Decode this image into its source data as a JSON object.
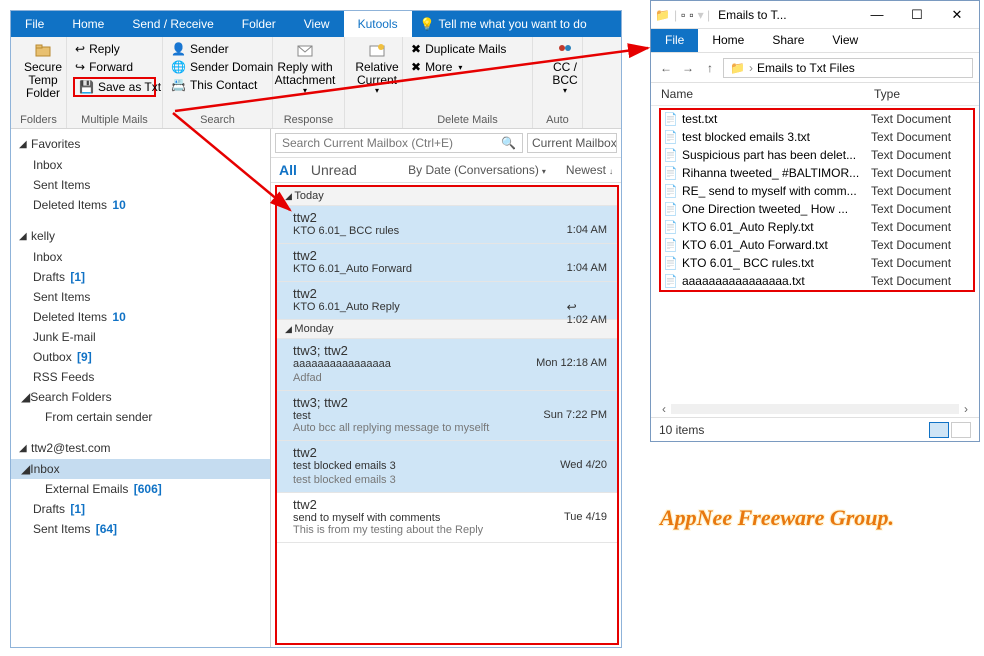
{
  "outlook": {
    "tabs": [
      "File",
      "Home",
      "Send / Receive",
      "Folder",
      "View",
      "Kutools"
    ],
    "tell_me": "Tell me what you want to do",
    "ribbon": {
      "folders": {
        "secure_temp": "Secure\nTemp Folder",
        "label": "Folders"
      },
      "multiple": {
        "reply": "Reply",
        "forward": "Forward",
        "save_as_txt": "Save as Txt",
        "label": "Multiple Mails"
      },
      "search": {
        "sender": "Sender",
        "sender_domain": "Sender Domain",
        "this_contact": "This Contact",
        "label": "Search"
      },
      "response": {
        "reply_attach": "Reply with\nAttachment",
        "label": "Response"
      },
      "relative": {
        "current": "Relative\nCurrent",
        "label": ""
      },
      "delete": {
        "duplicate": "Duplicate Mails",
        "more": "More",
        "label": "Delete Mails"
      },
      "ccbcc": {
        "ccbcc": "CC /\nBCC",
        "label": "Auto"
      }
    },
    "nav": {
      "favorites": {
        "label": "Favorites",
        "items": [
          {
            "label": "Inbox"
          },
          {
            "label": "Sent Items"
          },
          {
            "label": "Deleted Items",
            "count": "10"
          }
        ]
      },
      "kelly": {
        "label": "kelly",
        "items": [
          {
            "label": "Inbox"
          },
          {
            "label": "Drafts",
            "count": "[1]"
          },
          {
            "label": "Sent Items"
          },
          {
            "label": "Deleted Items",
            "count": "10"
          },
          {
            "label": "Junk E-mail"
          },
          {
            "label": "Outbox",
            "count": "[9]"
          },
          {
            "label": "RSS Feeds"
          },
          {
            "label": "Search Folders",
            "expandable": true
          },
          {
            "label": "From certain sender",
            "sub": true
          }
        ]
      },
      "ttw2": {
        "label": "ttw2@test.com",
        "items": [
          {
            "label": "Inbox",
            "expandable": true,
            "selected": true
          },
          {
            "label": "External Emails",
            "count": "[606]",
            "sub": true
          },
          {
            "label": "Drafts",
            "count": "[1]"
          },
          {
            "label": "Sent Items",
            "count": "[64]"
          }
        ]
      }
    },
    "search": {
      "placeholder": "Search Current Mailbox (Ctrl+E)",
      "scope": "Current Mailbox"
    },
    "filters": {
      "all": "All",
      "unread": "Unread",
      "by": "By Date (Conversations)",
      "newest": "Newest"
    },
    "messages": {
      "groups": [
        {
          "label": "Today",
          "items": [
            {
              "from": "ttw2",
              "subj": "KTO 6.01_ BCC rules",
              "time": "1:04 AM",
              "sel": true
            },
            {
              "from": "ttw2",
              "subj": "KTO 6.01_Auto Forward",
              "time": "1:04 AM",
              "sel": true
            },
            {
              "from": "ttw2",
              "subj": "KTO 6.01_Auto Reply",
              "time": "1:02 AM",
              "sel": true,
              "icon": "reply"
            }
          ]
        },
        {
          "label": "Monday",
          "items": [
            {
              "from": "ttw3; ttw2",
              "subj": "aaaaaaaaaaaaaaaa",
              "prev": "Adfad <end>",
              "time": "Mon 12:18 AM",
              "sel": true
            },
            {
              "from": "ttw3; ttw2",
              "subj": "test",
              "prev": "Auto bcc all replying message to myselft",
              "time": "Sun 7:22 PM",
              "sel": true
            },
            {
              "from": "ttw2",
              "subj": "test blocked emails 3",
              "prev": "test blocked emails 3 <end>",
              "time": "Wed 4/20",
              "sel": true
            },
            {
              "from": "ttw2",
              "subj": "send to myself with comments",
              "prev": "This is from my testing about the Reply",
              "time": "Tue 4/19",
              "plain": true
            }
          ]
        }
      ]
    }
  },
  "explorer": {
    "title": "Emails to T...",
    "tabs": [
      "File",
      "Home",
      "Share",
      "View"
    ],
    "crumb": "Emails to Txt Files",
    "cols": {
      "name": "Name",
      "type": "Type"
    },
    "files": [
      {
        "name": "test.txt",
        "type": "Text Document"
      },
      {
        "name": "test blocked emails 3.txt",
        "type": "Text Document"
      },
      {
        "name": "Suspicious part has been delet...",
        "type": "Text Document"
      },
      {
        "name": "Rihanna tweeted_ #BALTIMOR...",
        "type": "Text Document"
      },
      {
        "name": "RE_ send to myself with comm...",
        "type": "Text Document"
      },
      {
        "name": "One Direction tweeted_ How ...",
        "type": "Text Document"
      },
      {
        "name": "KTO 6.01_Auto Reply.txt",
        "type": "Text Document"
      },
      {
        "name": "KTO 6.01_Auto Forward.txt",
        "type": "Text Document"
      },
      {
        "name": "KTO 6.01_ BCC rules.txt",
        "type": "Text Document"
      },
      {
        "name": "aaaaaaaaaaaaaaaa.txt",
        "type": "Text Document"
      }
    ],
    "status": "10 items"
  },
  "watermark": "AppNee Freeware Group."
}
